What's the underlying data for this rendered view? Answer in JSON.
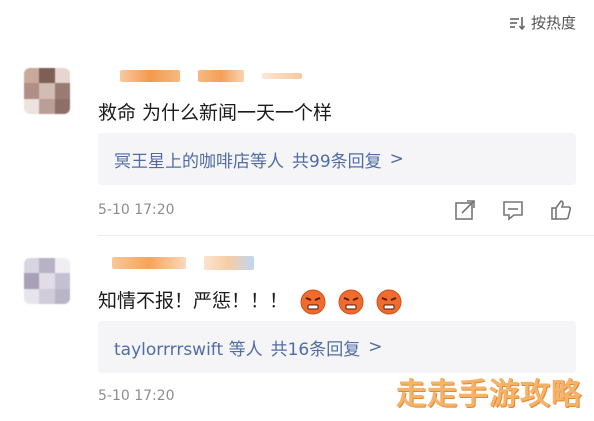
{
  "sort": {
    "label": "按热度",
    "icon": "sort-icon"
  },
  "comments": [
    {
      "text": "救命 为什么新闻一天一个样",
      "reply_summary": {
        "user": "冥王星上的咖啡店等人",
        "count_text": "共99条回复",
        "chevron": ">"
      },
      "time": "5-10 17:20",
      "emojis": []
    },
    {
      "text": "知情不报！严惩！！！",
      "reply_summary": {
        "user": "taylorrrrswift 等人",
        "count_text": "共16条回复",
        "chevron": ">"
      },
      "time": "5-10 17:20",
      "emojis": [
        "angry-face-emoji",
        "angry-face-emoji",
        "angry-face-emoji"
      ]
    }
  ],
  "action_icons": [
    "share-icon",
    "comment-icon",
    "like-icon"
  ],
  "watermark": "走走手游攻略",
  "colors": {
    "link_blue": "#4f6da4",
    "blur_orange": "#f5a25a",
    "watermark_orange": "#f7b26a"
  }
}
